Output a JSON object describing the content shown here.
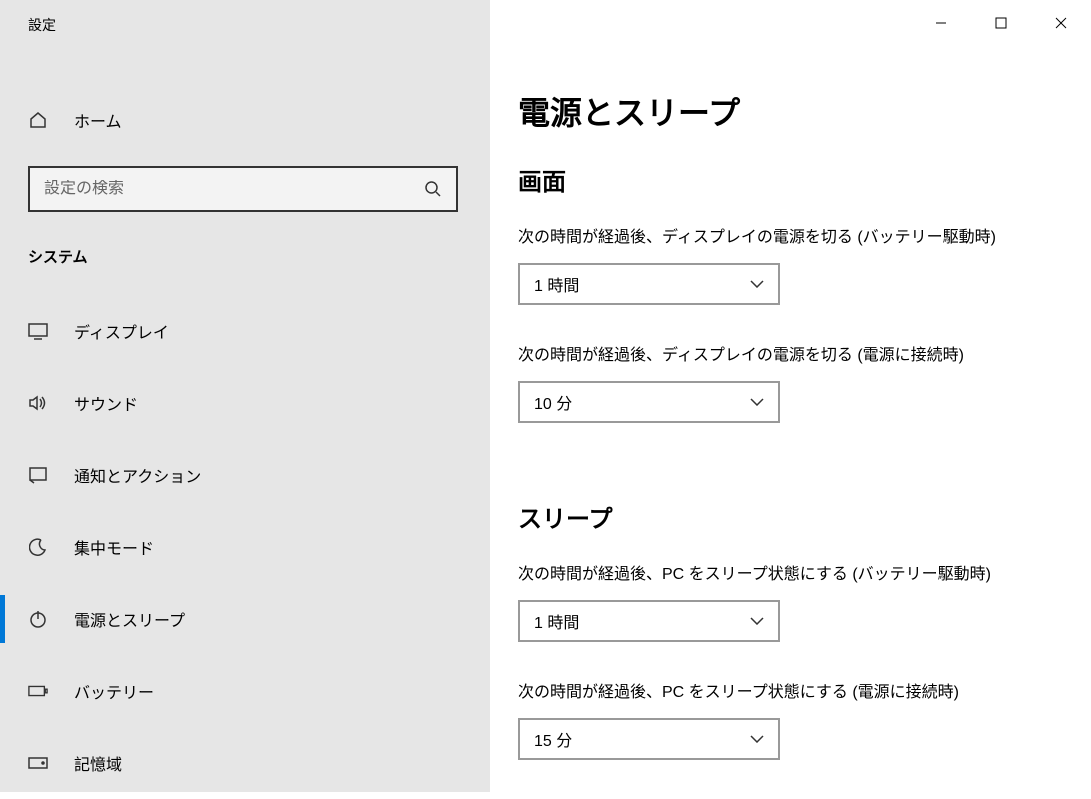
{
  "window": {
    "title": "設定"
  },
  "sidebar": {
    "home_label": "ホーム",
    "search_placeholder": "設定の検索",
    "category": "システム",
    "items": [
      {
        "label": "ディスプレイ"
      },
      {
        "label": "サウンド"
      },
      {
        "label": "通知とアクション"
      },
      {
        "label": "集中モード"
      },
      {
        "label": "電源とスリープ"
      },
      {
        "label": "バッテリー"
      },
      {
        "label": "記憶域"
      }
    ]
  },
  "main": {
    "title": "電源とスリープ",
    "section_screen": "画面",
    "screen_battery_label": "次の時間が経過後、ディスプレイの電源を切る (バッテリー駆動時)",
    "screen_battery_value": "1 時間",
    "screen_plugged_label": "次の時間が経過後、ディスプレイの電源を切る (電源に接続時)",
    "screen_plugged_value": "10 分",
    "section_sleep": "スリープ",
    "sleep_battery_label": "次の時間が経過後、PC をスリープ状態にする (バッテリー駆動時)",
    "sleep_battery_value": "1 時間",
    "sleep_plugged_label": "次の時間が経過後、PC をスリープ状態にする (電源に接続時)",
    "sleep_plugged_value": "15 分"
  }
}
